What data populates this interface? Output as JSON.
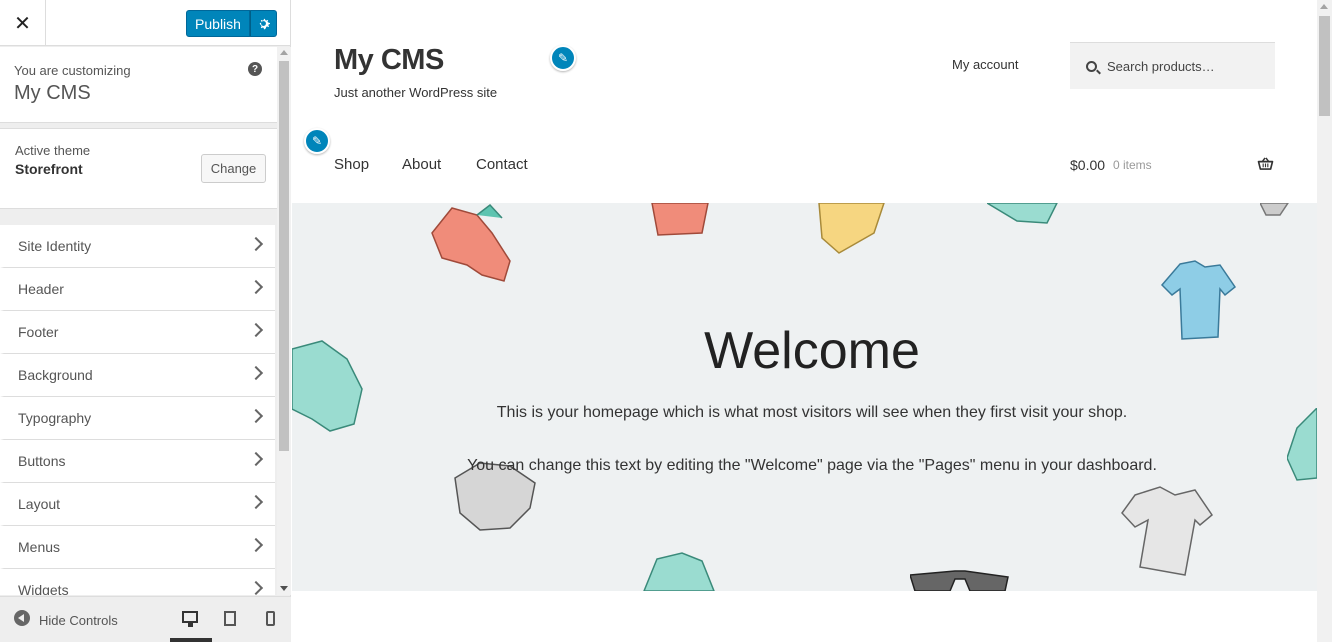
{
  "sidebar": {
    "close_label": "✕",
    "publish_label": "Publish",
    "customizing_label": "You are customizing",
    "site_name": "My CMS",
    "help_glyph": "?",
    "active_theme_label": "Active theme",
    "active_theme_name": "Storefront",
    "change_label": "Change",
    "items": [
      {
        "label": "Site Identity"
      },
      {
        "label": "Header"
      },
      {
        "label": "Footer"
      },
      {
        "label": "Background"
      },
      {
        "label": "Typography"
      },
      {
        "label": "Buttons"
      },
      {
        "label": "Layout"
      },
      {
        "label": "Menus"
      },
      {
        "label": "Widgets"
      }
    ],
    "hide_controls_label": "Hide Controls"
  },
  "preview": {
    "site_title": "My CMS",
    "tagline": "Just another WordPress site",
    "account_label": "My account",
    "search_placeholder": "Search products…",
    "nav": [
      "Shop",
      "About",
      "Contact"
    ],
    "cart_total": "$0.00",
    "cart_items": "0 items",
    "hero_title": "Welcome",
    "hero_p1": "This is your homepage which is what most visitors will see when they first visit your shop.",
    "hero_p2": "You can change this text by editing the \"Welcome\" page via the \"Pages\" menu in your dashboard."
  },
  "colors": {
    "accent": "#0085ba",
    "hero_bg": "#eef1f2"
  },
  "icons": [
    "close-icon",
    "gear-icon",
    "help-icon",
    "chevron-right-icon",
    "pencil-icon",
    "search-icon",
    "basket-icon",
    "desktop-icon",
    "tablet-icon",
    "mobile-icon",
    "hide-arrow-icon"
  ]
}
